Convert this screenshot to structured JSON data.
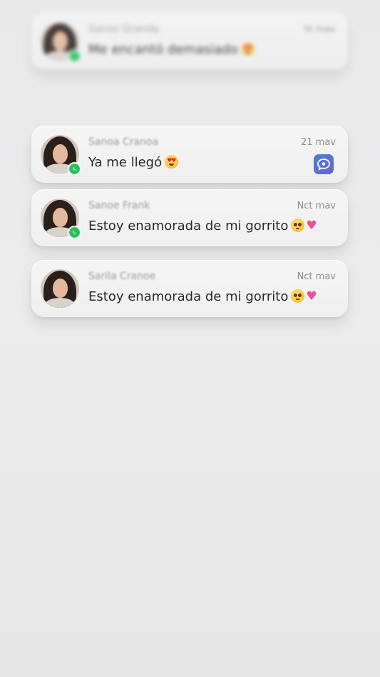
{
  "notifications": [
    {
      "sender": "Sanoe Granda",
      "time": "hl mav",
      "message": "Me encantó demasiado",
      "emoji": "😍",
      "badge": "whatsapp-icon",
      "blurred": true
    },
    {
      "sender": "Sanoa Cranoa",
      "time": "21 mav",
      "message": "Ya me llegó",
      "emoji": "😍",
      "badge": "whatsapp-icon",
      "app_icon": "messaging-app-icon"
    },
    {
      "sender": "Sanoe Frank",
      "time": "Nct mav",
      "message": "Estoy enamorada de mi gorrito",
      "emoji": "🥺💕",
      "badge": "whatsapp-icon"
    },
    {
      "sender": "Sarila Cranoe",
      "time": "Nct mav",
      "message": "Estoy enamorada de mi gorrito",
      "emoji": "🥺💕"
    }
  ],
  "colors": {
    "background": "#ebebec",
    "card": "#f3f3f3",
    "whatsapp": "#29c15a",
    "app_icon": "#5a70d0"
  }
}
